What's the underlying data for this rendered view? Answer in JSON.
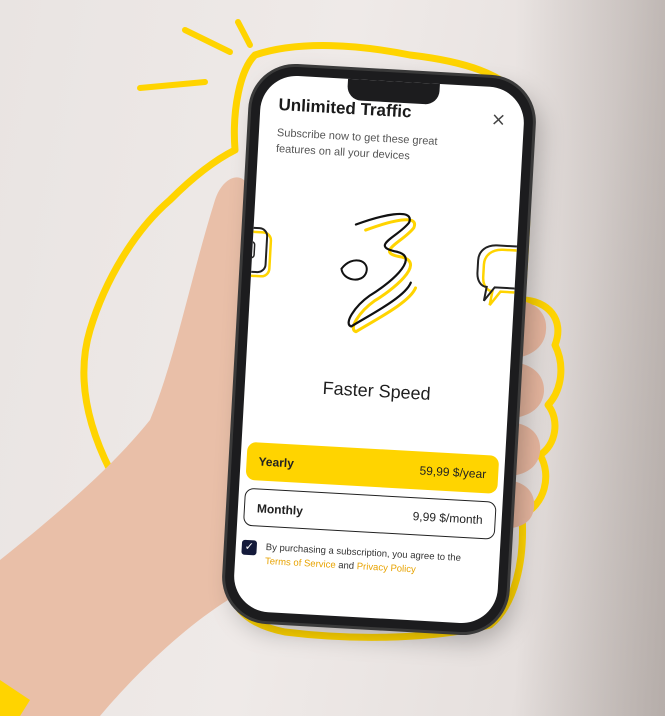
{
  "paywall": {
    "title": "Unlimited Traffic",
    "close_icon": "×",
    "subtitle": "Subscribe now to get these great features on all your devices",
    "feature_label": "Faster Speed",
    "plans": [
      {
        "name": "Yearly",
        "price": "59,99",
        "unit": "$/year",
        "selected": true
      },
      {
        "name": "Monthly",
        "price": "9,99",
        "unit": "$/month",
        "selected": false
      }
    ],
    "consent": {
      "checked": true,
      "checkmark": "✓",
      "text": "By purchasing a subscription, you agree to the",
      "terms_link": "Terms of Service",
      "and": "and",
      "privacy_link": "Privacy Policy"
    }
  },
  "colors": {
    "accent_yellow": "#ffd400",
    "link_orange": "#e8a300",
    "checkbox_navy": "#141a3a"
  },
  "icons": {
    "feature_icon": "lightning-scribble-icon",
    "left_peek_icon": "shield-icon",
    "right_peek_icon": "chat-bubble-icon"
  }
}
